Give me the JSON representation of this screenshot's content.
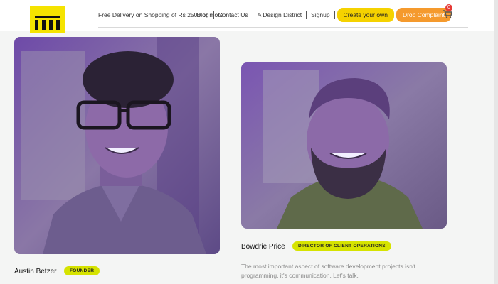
{
  "header": {
    "logo_name": "brand-logo",
    "promo": "Free Delivery on Shopping of Rs 2500 or more",
    "nav": {
      "blog": "Blog",
      "contact": "Contact Us",
      "design_district": "Design District",
      "signup": "Signup"
    },
    "buttons": {
      "create": "Create your own",
      "complaint": "Drop Complaint"
    },
    "cart_count": "0"
  },
  "team": [
    {
      "name": "Austin Betzer",
      "role": "FOUNDER",
      "bio": ""
    },
    {
      "name": "Bowdrie Price",
      "role": "DIRECTOR OF CLIENT OPERATIONS",
      "bio": "The most important aspect of software development projects isn't programming, it's communication. Let's talk."
    }
  ],
  "colors": {
    "logo": "#f5e300",
    "create_button": "#f5d200",
    "complaint_button": "#f59a2d",
    "role_badge": "#d6e300",
    "cart_badge": "#e53935",
    "photo_tint": "#7a4fbf"
  }
}
